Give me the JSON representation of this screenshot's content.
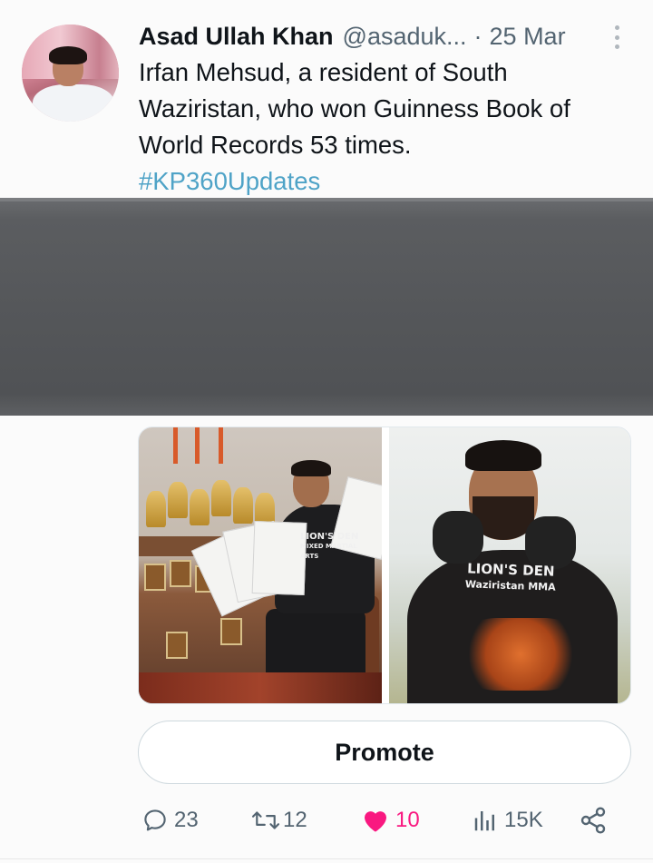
{
  "tweet": {
    "author_name": "Asad Ullah Khan",
    "handle": "@asaduk...",
    "separator": "·",
    "date": "25 Mar",
    "text_lines": [
      "Irfan Mehsud, a resident of South",
      "Waziristan, who won Guinness Book of",
      "World Records 53 times."
    ],
    "hashtag": "#KP360Updates"
  },
  "media": {
    "left_photo_shirt_text": [
      "LION'S DEN",
      "MIXED MARTIAL ARTS"
    ],
    "right_photo_shirt_text": [
      "LION'S DEN",
      "Waziristan MMA"
    ]
  },
  "promote": {
    "label": "Promote"
  },
  "actions": {
    "replies": "23",
    "reposts": "12",
    "likes": "10",
    "views": "15K"
  },
  "colors": {
    "accent_hashtag": "#4fa3c7",
    "like": "#f91880",
    "secondary_text": "#536471"
  }
}
